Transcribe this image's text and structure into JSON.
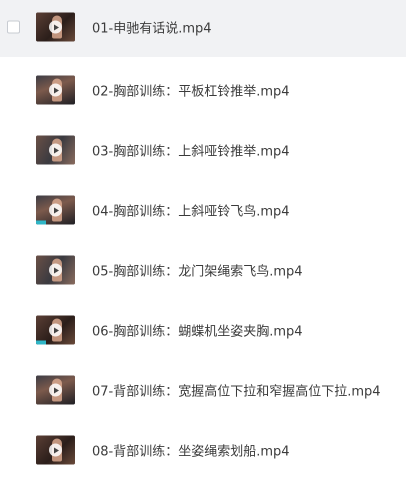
{
  "files": [
    {
      "name": "01-申驰有话说.mp4",
      "selected": true,
      "thumb_icon": "video-thumbnail-icon"
    },
    {
      "name": "02-胸部训练：平板杠铃推举.mp4",
      "selected": false,
      "thumb_icon": "video-thumbnail-icon"
    },
    {
      "name": "03-胸部训练：上斜哑铃推举.mp4",
      "selected": false,
      "thumb_icon": "video-thumbnail-icon"
    },
    {
      "name": "04-胸部训练：上斜哑铃飞鸟.mp4",
      "selected": false,
      "thumb_icon": "video-thumbnail-icon"
    },
    {
      "name": "05-胸部训练：龙门架绳索飞鸟.mp4",
      "selected": false,
      "thumb_icon": "video-thumbnail-icon"
    },
    {
      "name": "06-胸部训练：蝴蝶机坐姿夹胸.mp4",
      "selected": false,
      "thumb_icon": "video-thumbnail-icon"
    },
    {
      "name": "07-背部训练：宽握高位下拉和窄握高位下拉.mp4",
      "selected": false,
      "thumb_icon": "video-thumbnail-icon"
    },
    {
      "name": "08-背部训练：坐姿绳索划船.mp4",
      "selected": false,
      "thumb_icon": "video-thumbnail-icon"
    }
  ],
  "colors": {
    "selected_row_bg": "#f1f2f4",
    "text": "#3b3b3b",
    "checkbox_border": "#c8ccd2"
  }
}
